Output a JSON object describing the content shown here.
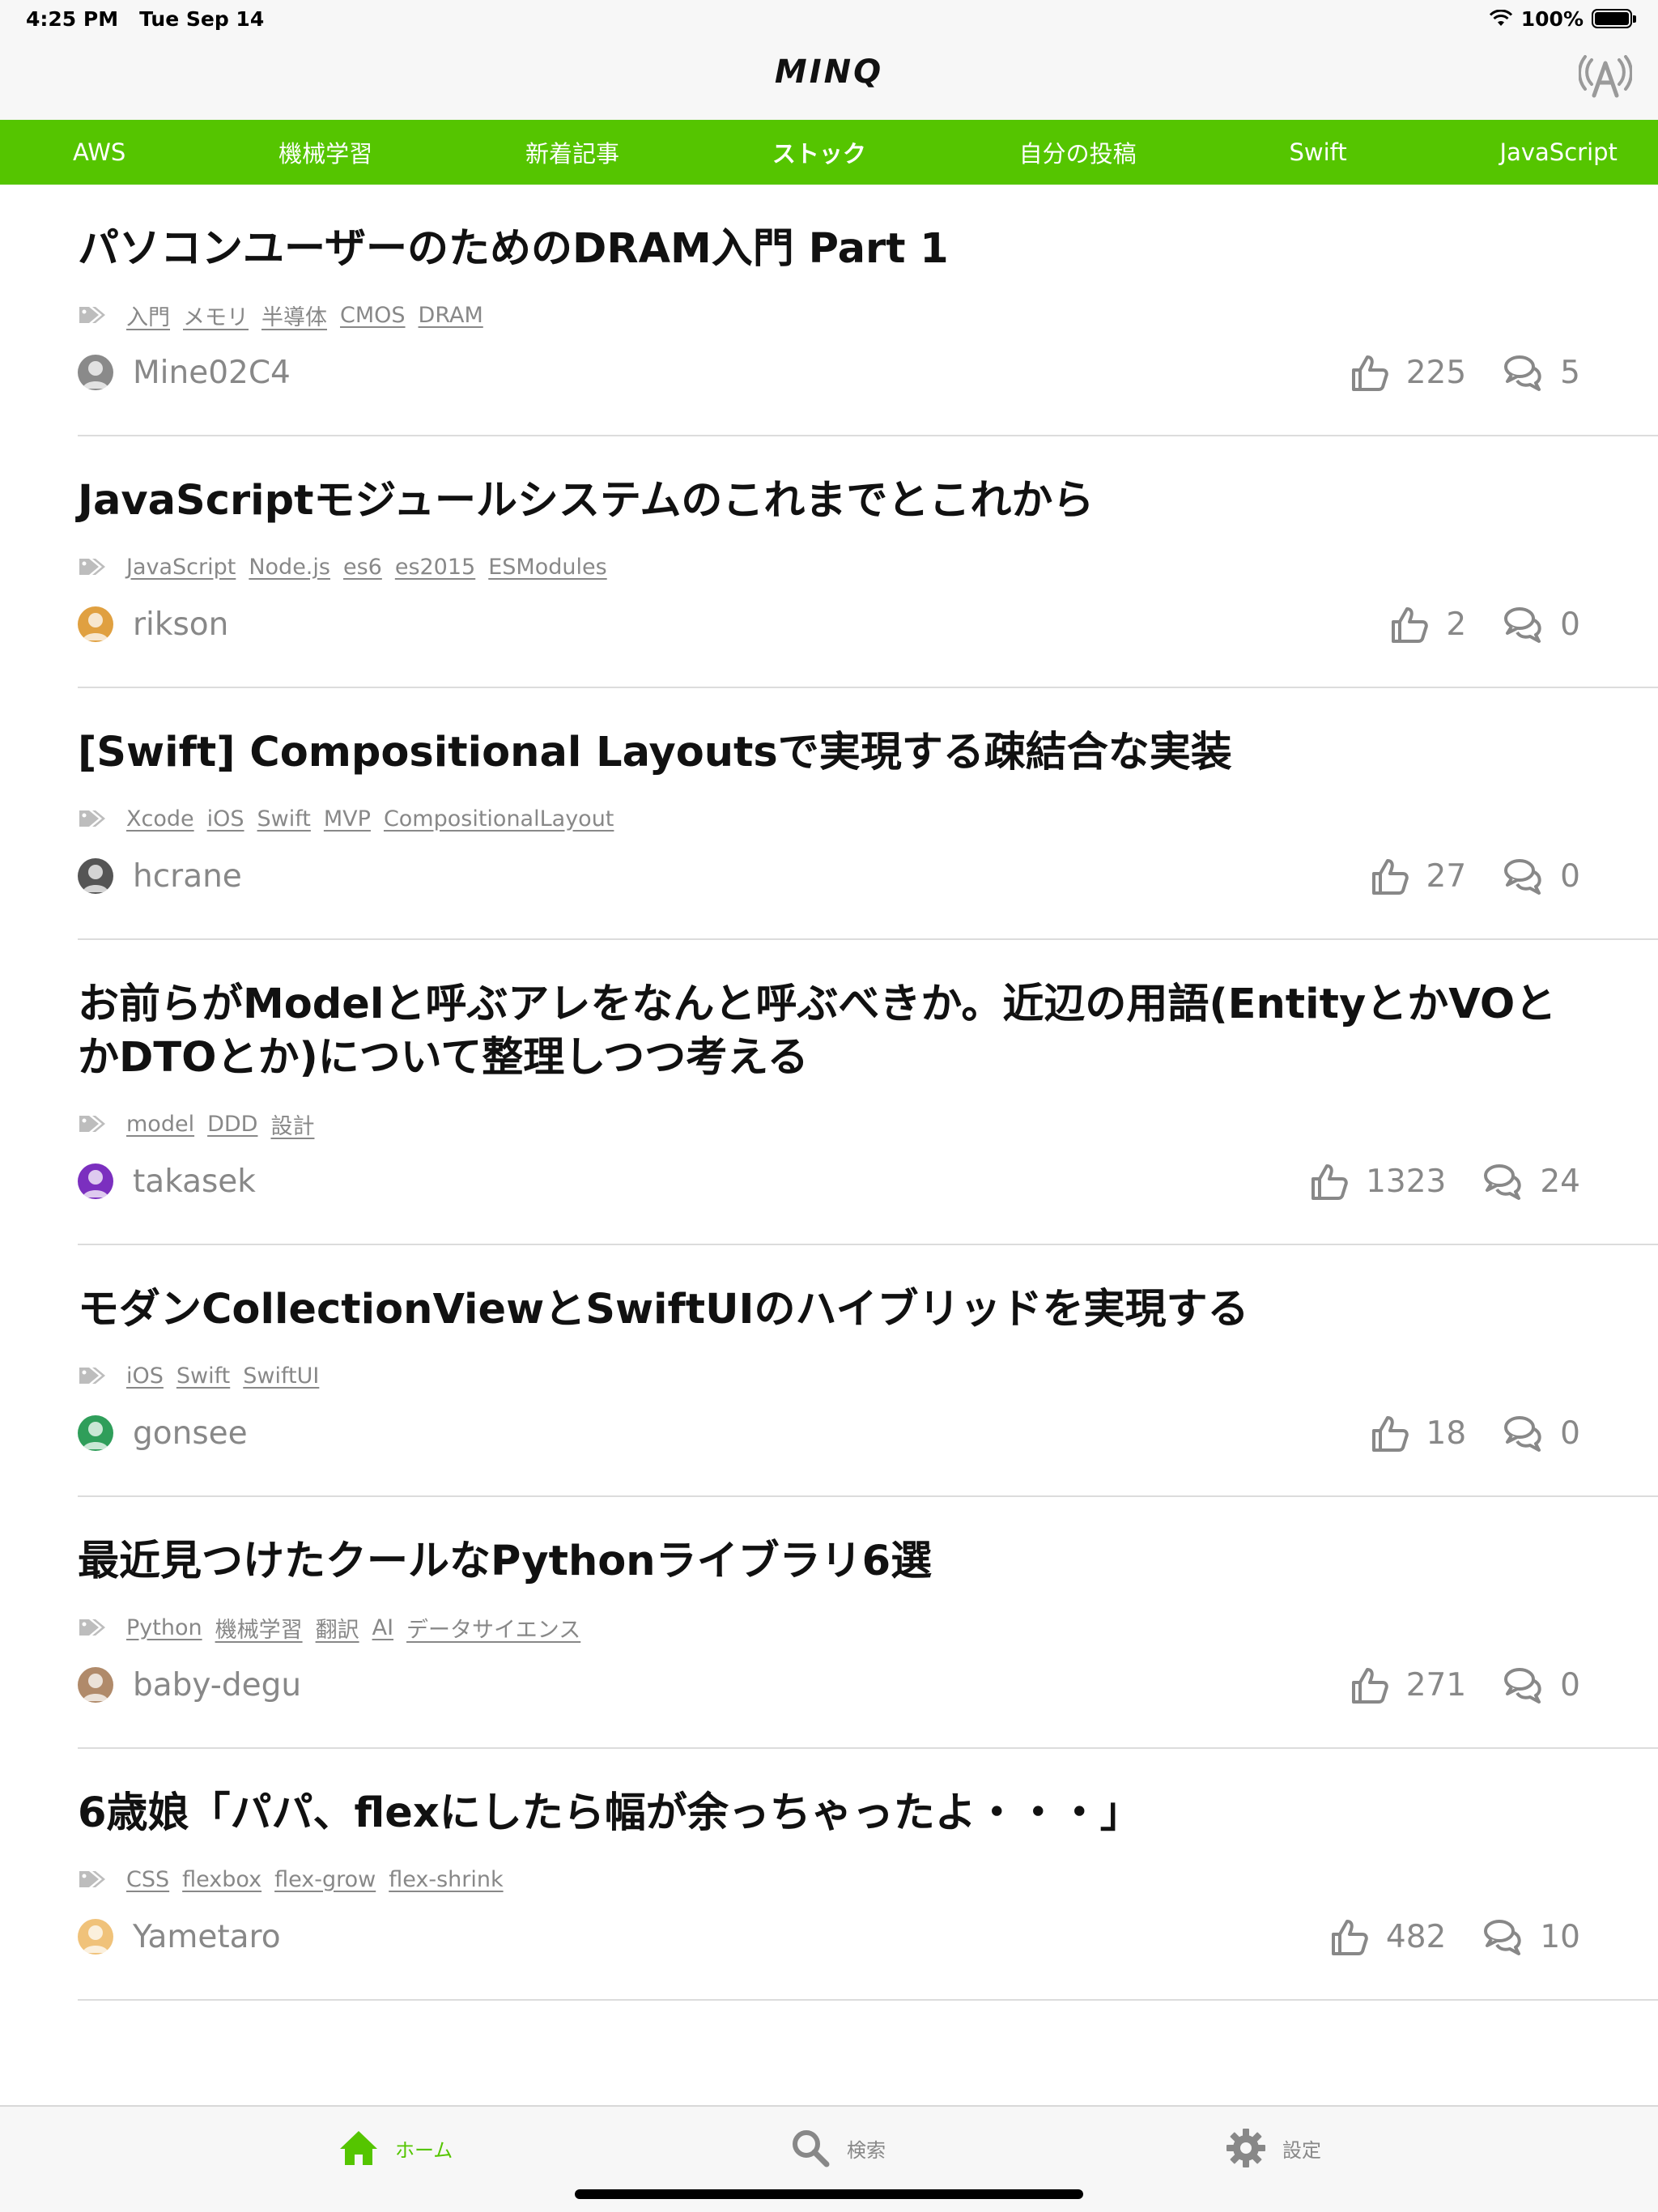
{
  "status": {
    "time": "4:25 PM",
    "date": "Tue Sep 14",
    "battery": "100%"
  },
  "app": {
    "logo": "MINQ"
  },
  "tabs": [
    {
      "label": "AWS"
    },
    {
      "label": "機械学習"
    },
    {
      "label": "新着記事"
    },
    {
      "label": "ストック",
      "active": true
    },
    {
      "label": "自分の投稿"
    },
    {
      "label": "Swift"
    },
    {
      "label": "JavaScript"
    }
  ],
  "articles": [
    {
      "title": "パソコンユーザーのためのDRAM入門 Part 1",
      "tags": [
        "入門",
        "メモリ",
        "半導体",
        "CMOS",
        "DRAM"
      ],
      "user": "Mine02C4",
      "likes": "225",
      "comments": "5",
      "avatar_color": "#8a8a8a"
    },
    {
      "title": "JavaScriptモジュールシステムのこれまでとこれから",
      "tags": [
        "JavaScript",
        "Node.js",
        "es6",
        "es2015",
        "ESModules"
      ],
      "user": "rikson",
      "likes": "2",
      "comments": "0",
      "avatar_color": "#e0a040"
    },
    {
      "title": "[Swift] Compositional Layoutsで実現する疎結合な実装",
      "tags": [
        "Xcode",
        "iOS",
        "Swift",
        "MVP",
        "CompositionalLayout"
      ],
      "user": "hcrane",
      "likes": "27",
      "comments": "0",
      "avatar_color": "#555555"
    },
    {
      "title": "お前らがModelと呼ぶアレをなんと呼ぶべきか。近辺の用語(EntityとかVOとかDTOとか)について整理しつつ考える",
      "tags": [
        "model",
        "DDD",
        "設計"
      ],
      "user": "takasek",
      "likes": "1323",
      "comments": "24",
      "avatar_color": "#7b2fbf"
    },
    {
      "title": "モダンCollectionViewとSwiftUIのハイブリッドを実現する",
      "tags": [
        "iOS",
        "Swift",
        "SwiftUI"
      ],
      "user": "gonsee",
      "likes": "18",
      "comments": "0",
      "avatar_color": "#2f9e5a"
    },
    {
      "title": "最近見つけたクールなPythonライブラリ6選",
      "tags": [
        "Python",
        "機械学習",
        "翻訳",
        "AI",
        "データサイエンス"
      ],
      "user": "baby-degu",
      "likes": "271",
      "comments": "0",
      "avatar_color": "#b08a6a"
    },
    {
      "title": "6歳娘「パパ、flexにしたら幅が余っちゃったよ・・・」",
      "tags": [
        "CSS",
        "flexbox",
        "flex-grow",
        "flex-shrink"
      ],
      "user": "Yametaro",
      "likes": "482",
      "comments": "10",
      "avatar_color": "#f0c27a"
    }
  ],
  "bottom_tabs": [
    {
      "label": "ホーム",
      "icon": "home-icon",
      "active": true
    },
    {
      "label": "検索",
      "icon": "search-icon"
    },
    {
      "label": "設定",
      "icon": "gear-icon"
    }
  ],
  "colors": {
    "accent": "#55c500",
    "muted": "#888888",
    "divider": "#dcdcdc"
  }
}
